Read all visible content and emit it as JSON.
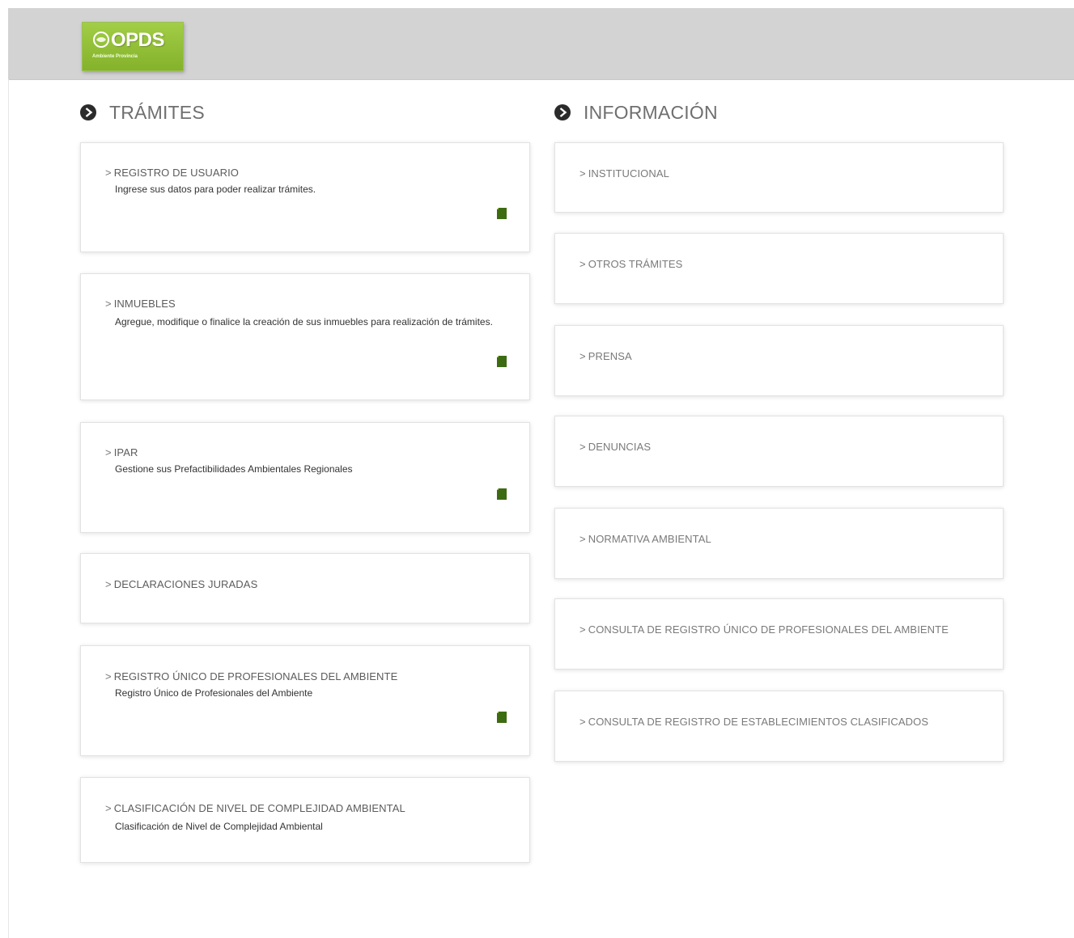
{
  "header": {
    "logo_text": "OPDS",
    "logo_subtext": "Ambiente Provincia"
  },
  "colors": {
    "header_bg": "#d3d3d3",
    "brand_green": "#8fbf30",
    "icon_green": "#3d6b12",
    "title_gray": "#6f6f6f"
  },
  "tramites": {
    "title": "TRÁMITES",
    "items": [
      {
        "label": "REGISTRO DE USUARIO",
        "description": "Ingrese sus datos para poder realizar trámites."
      },
      {
        "label": "INMUEBLES",
        "description": "Agregue, modifique o finalice la creación de sus inmuebles para realización de trámites."
      },
      {
        "label": "IPAR",
        "description": "Gestione sus Prefactibilidades Ambientales Regionales"
      },
      {
        "label": "DECLARACIONES JURADAS"
      },
      {
        "label": "REGISTRO ÚNICO DE PROFESIONALES DEL AMBIENTE",
        "description": "Registro Único de Profesionales del Ambiente"
      },
      {
        "label": "CLASIFICACIÓN DE NIVEL DE COMPLEJIDAD AMBIENTAL",
        "description": "Clasificación de Nivel de Complejidad Ambiental"
      }
    ]
  },
  "informacion": {
    "title": "INFORMACIÓN",
    "items": [
      {
        "label": "INSTITUCIONAL"
      },
      {
        "label": "OTROS TRÁMITES"
      },
      {
        "label": "PRENSA"
      },
      {
        "label": "DENUNCIAS"
      },
      {
        "label": "NORMATIVA AMBIENTAL"
      },
      {
        "label": "CONSULTA DE REGISTRO ÚNICO DE PROFESIONALES DEL AMBIENTE"
      },
      {
        "label": "CONSULTA DE REGISTRO DE ESTABLECIMIENTOS CLASIFICADOS"
      }
    ]
  },
  "icons": {
    "section_bullet": "circle-arrow-right-icon",
    "card_action": "document-icon"
  }
}
